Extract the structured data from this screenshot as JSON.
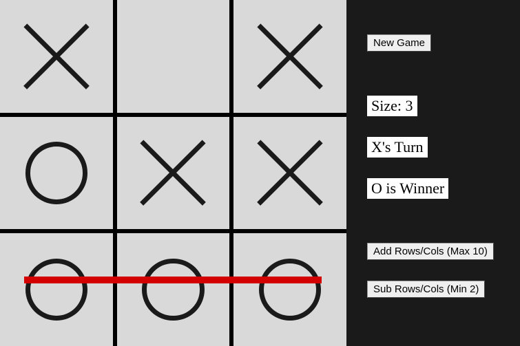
{
  "board": {
    "size": 3,
    "cells": [
      [
        "X",
        "",
        "X"
      ],
      [
        "O",
        "X",
        "X"
      ],
      [
        "O",
        "O",
        "O"
      ]
    ],
    "win_line": {
      "row": 2,
      "type": "row"
    }
  },
  "controls": {
    "new_game_label": "New Game",
    "add_label": "Add Rows/Cols (Max 10)",
    "sub_label": "Sub Rows/Cols (Min 2)"
  },
  "status": {
    "size_label": "Size: 3",
    "turn_label": "X's Turn",
    "winner_label": "O is Winner"
  }
}
